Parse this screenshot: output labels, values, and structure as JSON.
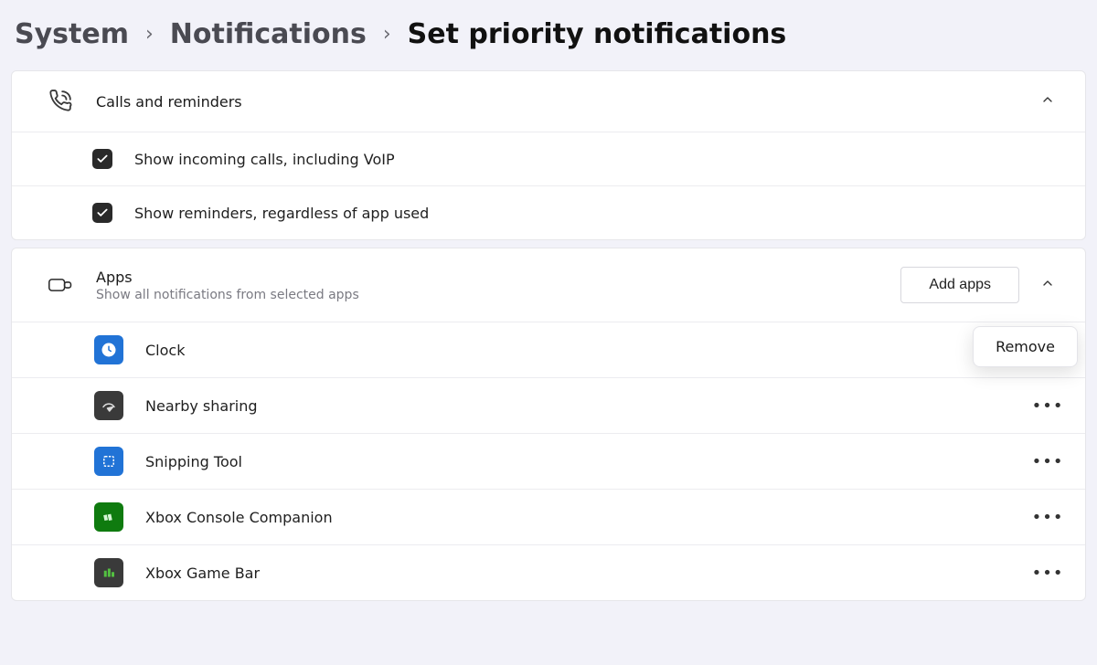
{
  "breadcrumb": {
    "system": "System",
    "notifications": "Notifications",
    "current": "Set priority notifications"
  },
  "calls_card": {
    "title": "Calls and reminders",
    "option_calls": "Show incoming calls, including VoIP",
    "option_reminders": "Show reminders, regardless of app used"
  },
  "apps_card": {
    "title": "Apps",
    "subtitle": "Show all notifications from selected apps",
    "add_button": "Add apps",
    "flyout_remove": "Remove",
    "apps": [
      {
        "name": "Clock"
      },
      {
        "name": "Nearby sharing"
      },
      {
        "name": "Snipping Tool"
      },
      {
        "name": "Xbox Console Companion"
      },
      {
        "name": "Xbox Game Bar"
      }
    ]
  }
}
